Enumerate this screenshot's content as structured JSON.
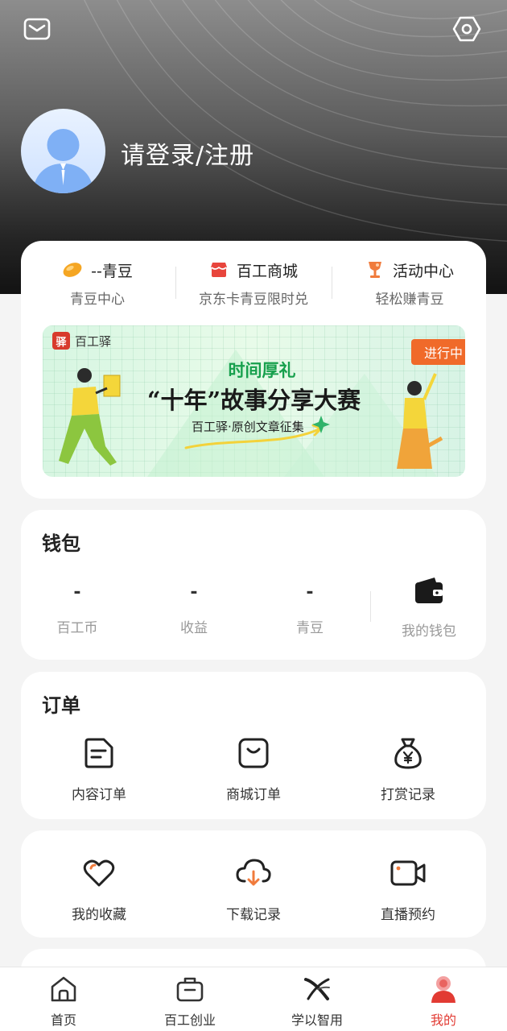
{
  "header": {
    "login_text": "请登录/注册",
    "icons": {
      "mail": "mail-icon",
      "settings": "settings-icon"
    }
  },
  "quick_links": [
    {
      "title": "--青豆",
      "sub": "青豆中心",
      "icon": "bean-icon"
    },
    {
      "title": "百工商城",
      "sub": "京东卡青豆限时兑",
      "icon": "shop-icon"
    },
    {
      "title": "活动中心",
      "sub": "轻松赚青豆",
      "icon": "trophy-icon"
    }
  ],
  "banner": {
    "brand": "百工驿",
    "brand_logo": "驿",
    "subtitle": "时间厚礼",
    "title": "“十年”故事分享大赛",
    "tagline": "百工驿·原创文章征集",
    "badge": "进行中"
  },
  "wallet": {
    "title": "钱包",
    "stats": [
      {
        "value": "-",
        "label": "百工币"
      },
      {
        "value": "-",
        "label": "收益"
      },
      {
        "value": "-",
        "label": "青豆"
      }
    ],
    "my_wallet": "我的钱包"
  },
  "orders": {
    "title": "订单",
    "items": [
      {
        "label": "内容订单",
        "icon": "content-order-icon"
      },
      {
        "label": "商城订单",
        "icon": "shop-order-icon"
      },
      {
        "label": "打赏记录",
        "icon": "money-bag-icon"
      }
    ]
  },
  "misc": {
    "items": [
      {
        "label": "我的收藏",
        "icon": "heart-icon"
      },
      {
        "label": "下载记录",
        "icon": "cloud-download-icon"
      },
      {
        "label": "直播预约",
        "icon": "video-icon"
      }
    ]
  },
  "tabbar": {
    "items": [
      {
        "label": "首页",
        "icon": "home-icon"
      },
      {
        "label": "百工创业",
        "icon": "briefcase-icon"
      },
      {
        "label": "学以智用",
        "icon": "x-logo-icon"
      },
      {
        "label": "我的",
        "icon": "profile-icon",
        "active": true
      }
    ]
  },
  "colors": {
    "accent": "#e23b33",
    "orange": "#f06a2a",
    "green": "#17a04d"
  }
}
